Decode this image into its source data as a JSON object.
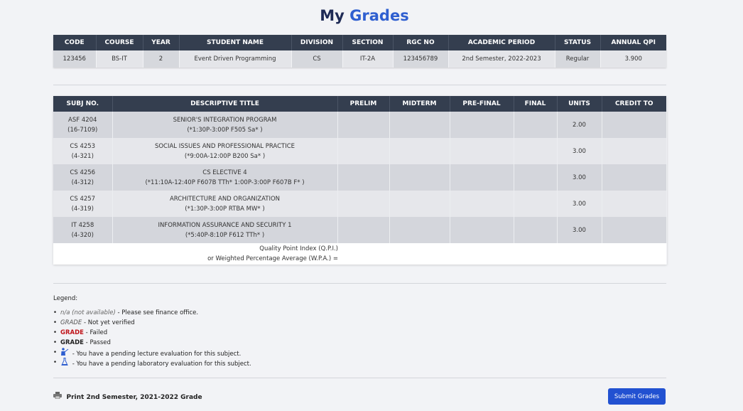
{
  "page": {
    "title_1": "My",
    "title_2": "Grades"
  },
  "info": {
    "headers": [
      "CODE",
      "COURSE",
      "YEAR",
      "STUDENT NAME",
      "DIVISION",
      "SECTION",
      "RGC NO",
      "ACADEMIC PERIOD",
      "STATUS",
      "ANNUAL QPI"
    ],
    "values": [
      "123456",
      "BS-IT",
      "2",
      "Event Driven Programming",
      "CS",
      "IT-2A",
      "123456789",
      "2nd Semester, 2022-2023",
      "Regular",
      "3.900"
    ]
  },
  "grades": {
    "headers": [
      "SUBJ NO.",
      "DESCRIPTIVE TITLE",
      "PRELIM",
      "MIDTERM",
      "PRE-FINAL",
      "FINAL",
      "UNITS",
      "CREDIT TO"
    ],
    "rows": [
      {
        "subj": "ASF 4204",
        "code": "(16-7109)",
        "title": "SENIOR'S INTEGRATION PROGRAM",
        "sched": "(*1:30P-3:00P F505 Sa* )",
        "units": "2.00"
      },
      {
        "subj": "CS 4253",
        "code": "(4-321)",
        "title": "SOCIAL ISSUES AND PROFESSIONAL PRACTICE",
        "sched": "(*9:00A-12:00P B200 Sa* )",
        "units": "3.00"
      },
      {
        "subj": "CS 4256",
        "code": "(4-312)",
        "title": "CS ELECTIVE 4",
        "sched": "(*11:10A-12:40P F607B TTh* 1:00P-3:00P F607B F* )",
        "units": "3.00"
      },
      {
        "subj": "CS 4257",
        "code": "(4-319)",
        "title": "ARCHITECTURE AND ORGANIZATION",
        "sched": "(*1:30P-3:00P RTBA MW* )",
        "units": "3.00"
      },
      {
        "subj": "IT 4258",
        "code": "(4-320)",
        "title": "INFORMATION ASSURANCE AND SECURITY 1",
        "sched": "(*5:40P-8:10P F612 TTh* )",
        "units": "3.00"
      }
    ],
    "qpi_line1": "Quality Point Index (Q.P.I.)",
    "qpi_line2": "or Weighted Percentage Average (W.P.A.) ="
  },
  "legend": {
    "title": "Legend:",
    "na": "n/a (not available)",
    "na_desc": "- Please see finance office.",
    "nv": "GRADE",
    "nv_desc": "- Not yet verified",
    "failed": "GRADE",
    "failed_desc": "- Failed",
    "passed": "GRADE",
    "passed_desc": "- Passed",
    "lecture_icon": "teacher-icon",
    "lecture_desc": "- You have a pending lecture evaluation for this subject.",
    "lab_icon": "flask-icon",
    "lab_desc": "- You have a pending laboratory evaluation for this subject."
  },
  "footer": {
    "print_icon": "printer-icon",
    "print_label": "Print 2nd Semester, 2021-2022 Grade",
    "submit_label": "Submit Grades"
  }
}
